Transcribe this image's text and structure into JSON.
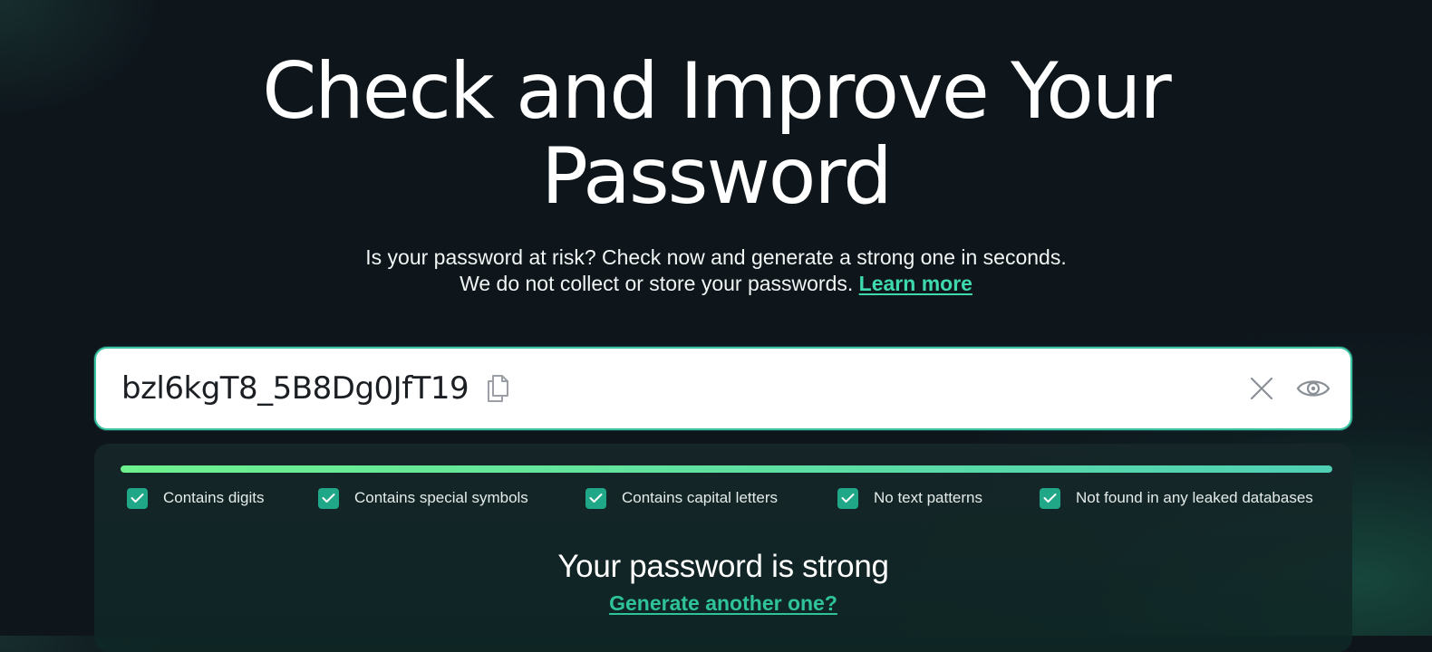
{
  "hero": {
    "title_line1": "Check and Improve Your",
    "title_line2": "Password",
    "subtitle_line1": "Is your password at risk? Check now and generate a strong one in seconds.",
    "subtitle_line2": "We do not collect or store your passwords.",
    "learn_more": "Learn more"
  },
  "password_field": {
    "value": "bzl6kgT8_5B8Dg0JfT19",
    "icons": {
      "copy": "copy-icon",
      "clear": "close-icon",
      "visibility": "eye-icon"
    }
  },
  "result": {
    "strength_fraction": 1.0,
    "criteria": [
      {
        "label": "Contains digits",
        "checked": true
      },
      {
        "label": "Contains special symbols",
        "checked": true
      },
      {
        "label": "Contains capital letters",
        "checked": true
      },
      {
        "label": "No text patterns",
        "checked": true
      },
      {
        "label": "Not found in any leaked databases",
        "checked": true
      }
    ],
    "verdict": "Your password is strong",
    "generate_link": "Generate another one?"
  },
  "colors": {
    "background": "#0e161c",
    "accent": "#3fd9ae",
    "checkbox": "#1fa787",
    "bar_start": "#6ff08e",
    "bar_end": "#4fd0b4"
  }
}
